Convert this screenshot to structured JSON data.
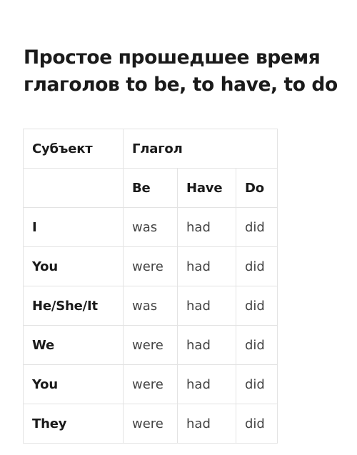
{
  "title": "Простое прошедшее время глаголов to be, to have, to do",
  "table": {
    "header": {
      "subject": "Субъект",
      "verb": "Глагол"
    },
    "subheader": {
      "subject": "",
      "be": "Be",
      "have": "Have",
      "do": "Do"
    },
    "rows": [
      {
        "subject": "I",
        "be": "was",
        "have": "had",
        "do": "did"
      },
      {
        "subject": "You",
        "be": "were",
        "have": "had",
        "do": "did"
      },
      {
        "subject": "He/She/It",
        "be": "was",
        "have": "had",
        "do": "did"
      },
      {
        "subject": "We",
        "be": "were",
        "have": "had",
        "do": "did"
      },
      {
        "subject": "You",
        "be": "were",
        "have": "had",
        "do": "did"
      },
      {
        "subject": "They",
        "be": "were",
        "have": "had",
        "do": "did"
      }
    ]
  }
}
